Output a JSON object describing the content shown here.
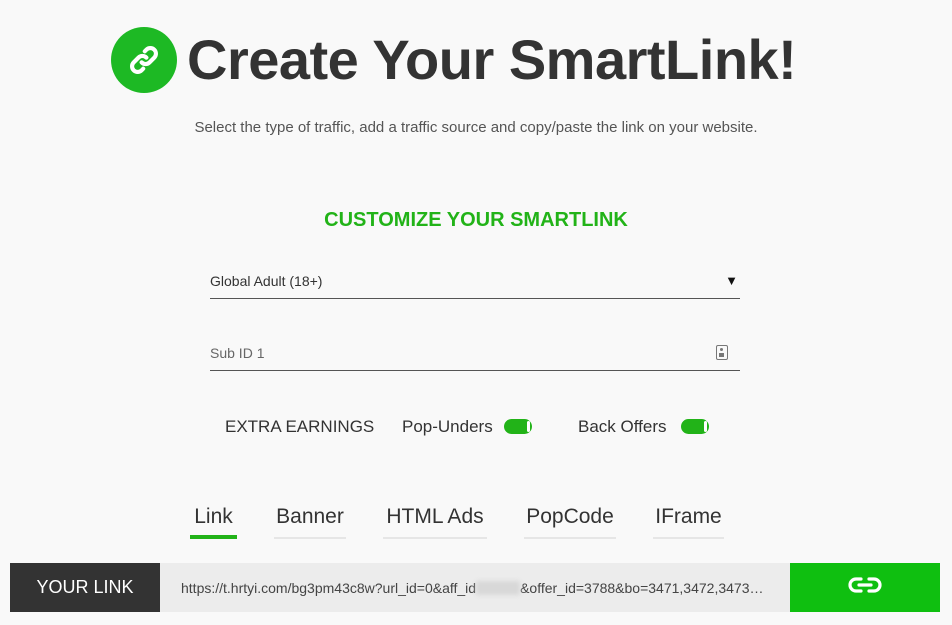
{
  "colors": {
    "accent": "#1db924",
    "section_title": "#22b318",
    "copy_button": "#0fbf10",
    "your_link_bg": "#333333"
  },
  "header": {
    "logo_icon": "link-icon",
    "title": "Create Your SmartLink!",
    "subtitle": "Select the type of traffic, add a traffic source and copy/paste the link on your website."
  },
  "customize": {
    "heading": "CUSTOMIZE YOUR SMARTLINK",
    "traffic_select": {
      "value": "Global Adult (18+)",
      "icon": "caret-down-icon"
    },
    "subid_field": {
      "placeholder": "Sub ID 1",
      "icon": "id-card-icon"
    }
  },
  "extras": {
    "label": "EXTRA EARNINGS",
    "toggles": [
      {
        "label": "Pop-Unders",
        "on": true
      },
      {
        "label": "Back Offers",
        "on": true
      }
    ]
  },
  "tabs": [
    {
      "label": "Link",
      "active": true
    },
    {
      "label": "Banner",
      "active": false
    },
    {
      "label": "HTML Ads",
      "active": false
    },
    {
      "label": "PopCode",
      "active": false
    },
    {
      "label": "IFrame",
      "active": false
    }
  ],
  "link_bar": {
    "label": "YOUR LINK",
    "url_prefix": "https://t.hrtyi.com/bg3pm43c8w?url_id=0&aff_id",
    "url_suffix": "&offer_id=3788&bo=3471,3472,3473…",
    "copy_icon": "link-icon"
  }
}
